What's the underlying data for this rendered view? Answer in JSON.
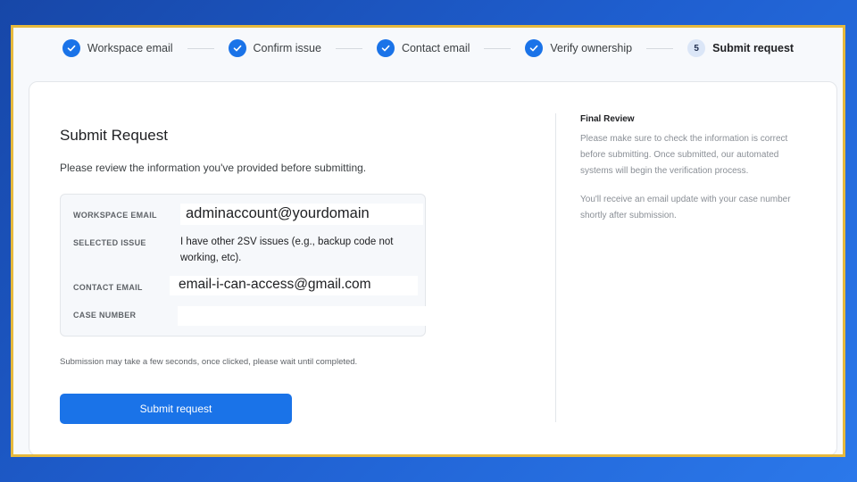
{
  "stepper": {
    "steps": [
      {
        "label": "Workspace email",
        "state": "done"
      },
      {
        "label": "Confirm issue",
        "state": "done"
      },
      {
        "label": "Contact email",
        "state": "done"
      },
      {
        "label": "Verify ownership",
        "state": "done"
      },
      {
        "label": "Submit request",
        "state": "current",
        "number": "5"
      }
    ]
  },
  "main": {
    "title": "Submit Request",
    "subtitle": "Please review the information you've provided before submitting.",
    "review": {
      "workspace_email_label": "WORKSPACE EMAIL",
      "workspace_email_value": "adminaccount@yourdomain",
      "selected_issue_label": "SELECTED ISSUE",
      "selected_issue_value": "I have other 2SV issues (e.g., backup code not working, etc).",
      "contact_email_label": "CONTACT EMAIL",
      "contact_email_value": "email-i-can-access@gmail.com",
      "case_number_label": "CASE NUMBER",
      "case_number_value": ""
    },
    "note": "Submission may take a few seconds, once clicked, please wait until completed.",
    "submit_label": "Submit request"
  },
  "sidebar": {
    "title": "Final Review",
    "paragraph1": "Please make sure to check the information is correct before submitting. Once submitted, our automated systems will begin the verification process.",
    "paragraph2": "You'll receive an email update with your case number shortly after submission."
  },
  "colors": {
    "accent": "#1a73e8",
    "frame_border": "#e6b93d",
    "background": "#1f5fd0"
  }
}
